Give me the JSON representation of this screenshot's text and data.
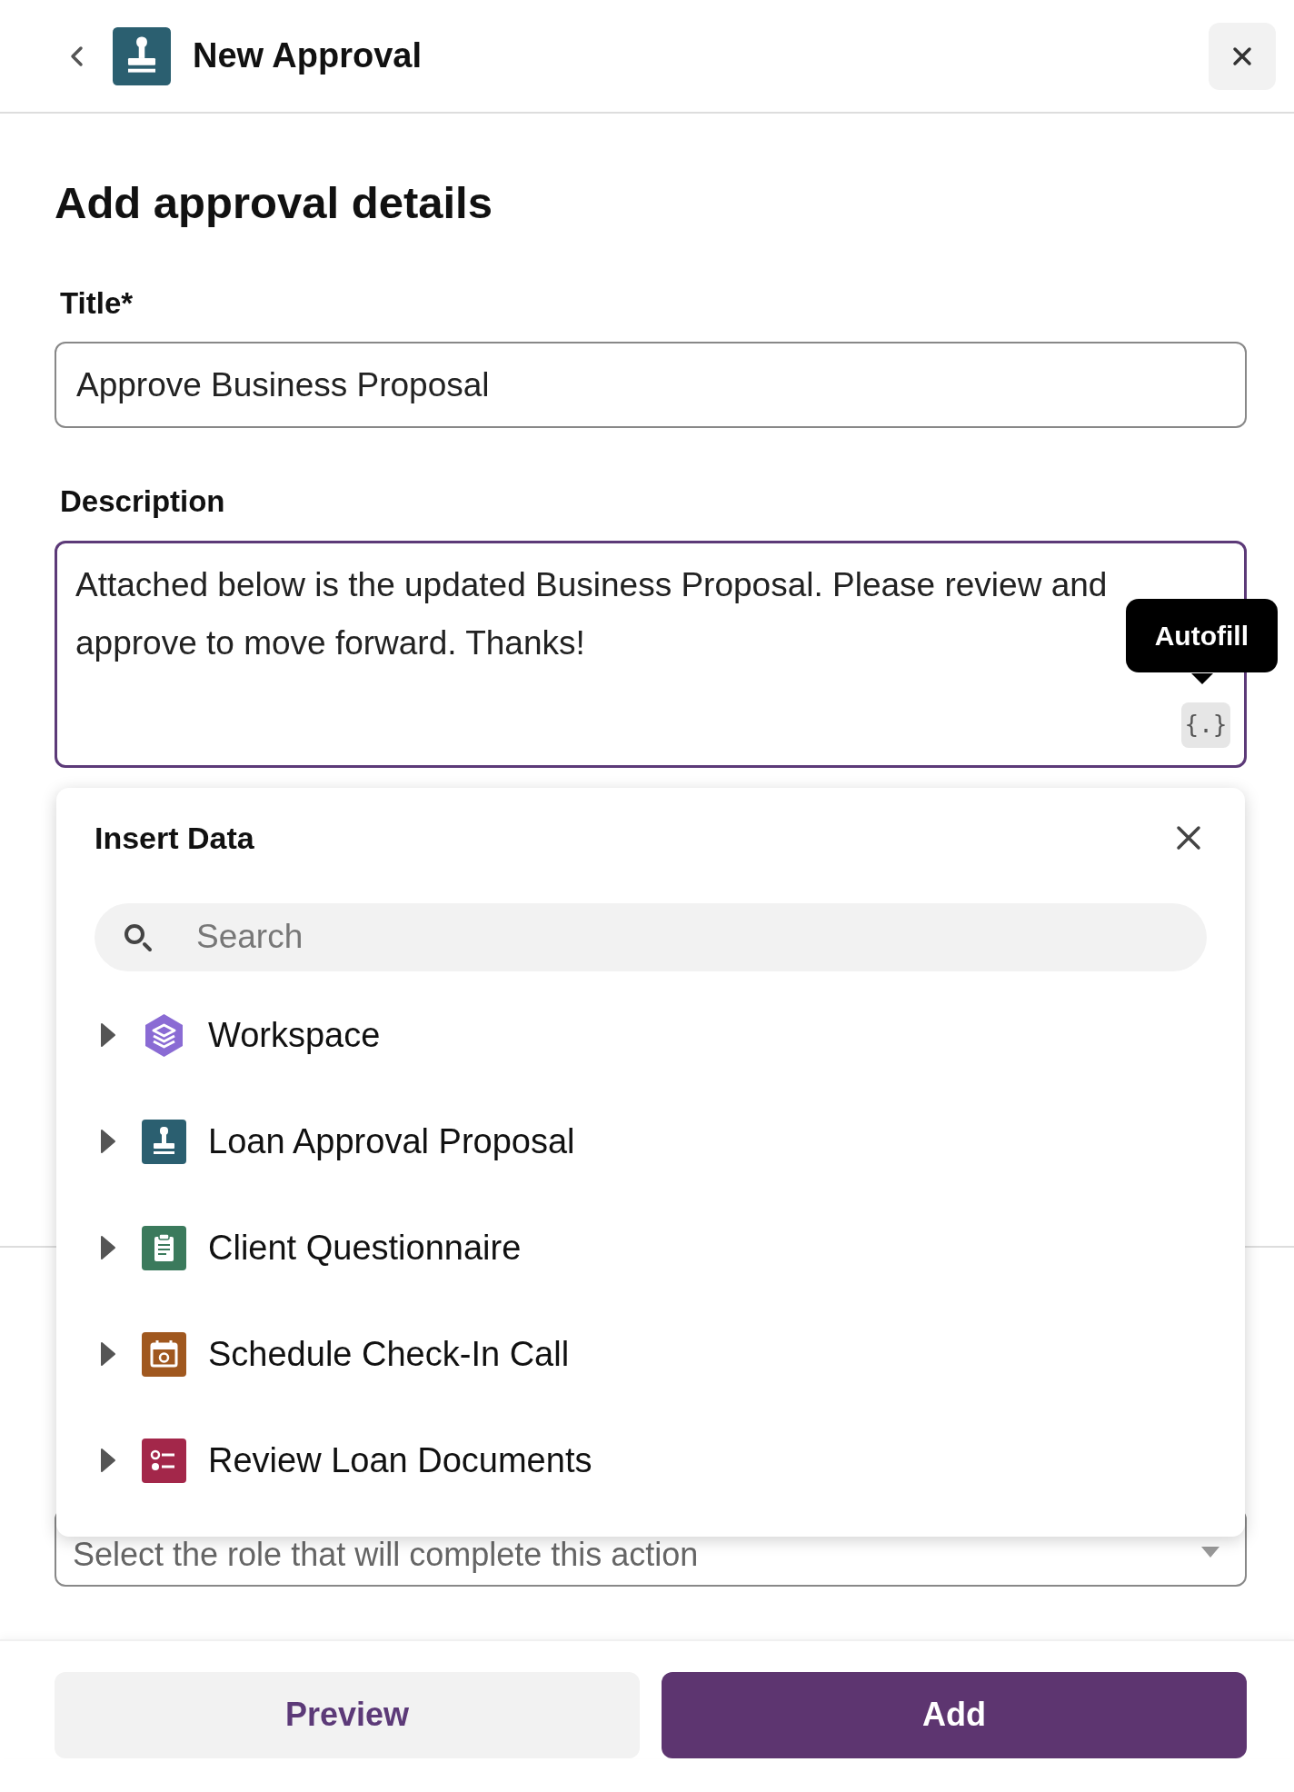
{
  "header": {
    "title": "New Approval"
  },
  "heading": "Add approval details",
  "fields": [
    {
      "label": "Title*",
      "value": "Approve Business Proposal",
      "kind": "input"
    },
    {
      "label": "Description",
      "value": "Attached below is the updated Business Proposal. Please review and approve to move forward. Thanks!",
      "kind": "textarea"
    }
  ],
  "tooltip": "Autofill",
  "autofill_button": "{.}",
  "insert_data": {
    "title": "Insert Data",
    "search": {
      "placeholder": "Search"
    },
    "items": [
      {
        "label": "Workspace",
        "kind": "workspace",
        "color": "#8a6bd4"
      },
      {
        "label": "Loan Approval Proposal",
        "kind": "stamp",
        "color": "#2b5f70"
      },
      {
        "label": "Client Questionnaire",
        "kind": "clipboard",
        "color": "#3b7a5c"
      },
      {
        "label": "Schedule Check-In Call",
        "kind": "calendar",
        "color": "#a0581f"
      },
      {
        "label": "Review Loan Documents",
        "kind": "checklist",
        "color": "#a3274a"
      }
    ]
  },
  "role_select": {
    "placeholder": "Select the role that will complete this action"
  },
  "buttons": [
    {
      "label": "Preview",
      "kind": "secondary"
    },
    {
      "label": "Add",
      "kind": "primary"
    }
  ]
}
